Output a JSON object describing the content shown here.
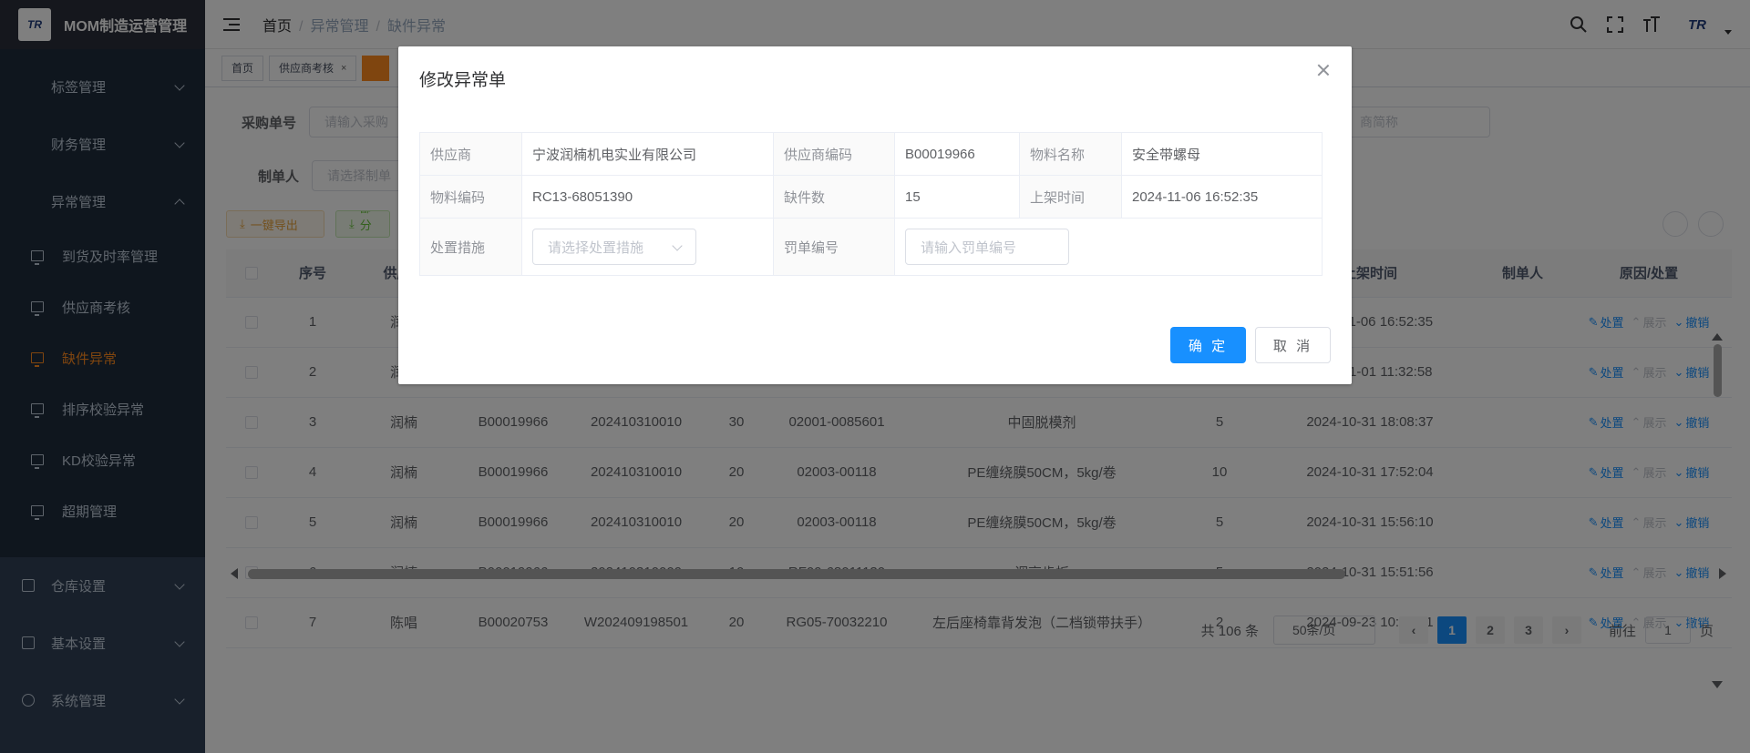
{
  "app": {
    "title": "MOM制造运营管理",
    "logo_text": "TR"
  },
  "sidebar": {
    "top_items": [
      {
        "label": "标签管理"
      },
      {
        "label": "财务管理"
      },
      {
        "label": "异常管理"
      }
    ],
    "sub_items": [
      {
        "label": "到货及时率管理"
      },
      {
        "label": "供应商考核"
      },
      {
        "label": "缺件异常"
      },
      {
        "label": "排序校验异常"
      },
      {
        "label": "KD校验异常"
      },
      {
        "label": "超期管理"
      }
    ],
    "lower_items": [
      {
        "label": "仓库设置"
      },
      {
        "label": "基本设置"
      },
      {
        "label": "系统管理"
      }
    ]
  },
  "breadcrumb": {
    "home": "首页",
    "section": "异常管理",
    "current": "缺件异常"
  },
  "tags": {
    "home": "首页",
    "supplier": "供应商考核",
    "close": "×"
  },
  "filters": {
    "purchase_no_label": "采购单号",
    "purchase_no_placeholder": "请输入采购",
    "creator_label": "制单人",
    "creator_placeholder": "请选择制单",
    "supplier_short_placeholder": "商简称"
  },
  "toolbar": {
    "export_label": "一键导出",
    "partial_label": "部分导"
  },
  "table": {
    "headers": {
      "index": "序号",
      "supplier": "供应商",
      "shelf_time": "上架时间",
      "creator": "制单人",
      "reason": "原因/处置"
    },
    "actions": {
      "handle": "处置",
      "show": "展示",
      "revoke": "撤销"
    },
    "rows": [
      {
        "idx": "1",
        "supplier": "润楠",
        "code": "",
        "po": "",
        "line": "",
        "material": "",
        "name": "",
        "qty": "",
        "time": "2024-11-06 16:52:35"
      },
      {
        "idx": "2",
        "supplier": "润楠",
        "code": "",
        "po": "",
        "line": "",
        "material": "",
        "name": "",
        "qty": "",
        "time": "2024-11-01 11:32:58"
      },
      {
        "idx": "3",
        "supplier": "润楠",
        "code": "B00019966",
        "po": "202410310010",
        "line": "30",
        "material": "02001-0085601",
        "name": "中固脱模剂",
        "qty": "5",
        "time": "2024-10-31 18:08:37"
      },
      {
        "idx": "4",
        "supplier": "润楠",
        "code": "B00019966",
        "po": "202410310010",
        "line": "20",
        "material": "02003-00118",
        "name": "PE缠绕膜50CM，5kg/卷",
        "qty": "10",
        "time": "2024-10-31 17:52:04"
      },
      {
        "idx": "5",
        "supplier": "润楠",
        "code": "B00019966",
        "po": "202410310010",
        "line": "20",
        "material": "02003-00118",
        "name": "PE缠绕膜50CM，5kg/卷",
        "qty": "5",
        "time": "2024-10-31 15:56:10"
      },
      {
        "idx": "6",
        "supplier": "润楠",
        "code": "B00019966",
        "po": "202410310009",
        "line": "10",
        "material": "RF09-68011130",
        "name": "调高齿板",
        "qty": "5",
        "time": "2024-10-31 15:51:56"
      },
      {
        "idx": "7",
        "supplier": "陈唱",
        "code": "B00020753",
        "po": "W202409198501",
        "line": "20",
        "material": "RG05-70032210",
        "name": "左后座椅靠背发泡（二档锁带扶手）",
        "qty": "2",
        "time": "2024-09-23 10:31:21"
      }
    ]
  },
  "pager": {
    "total": "共 106 条",
    "page_size": "50条/页",
    "pages": [
      "1",
      "2",
      "3"
    ],
    "goto_label": "前往",
    "goto_value": "1",
    "page_unit": "页"
  },
  "dialog": {
    "title": "修改异常单",
    "fields": {
      "supplier_label": "供应商",
      "supplier_value": "宁波润楠机电实业有限公司",
      "supplier_code_label": "供应商编码",
      "supplier_code_value": "B00019966",
      "material_name_label": "物料名称",
      "material_name_value": "安全带螺母",
      "material_code_label": "物料编码",
      "material_code_value": "RC13-68051390",
      "shortage_label": "缺件数",
      "shortage_value": "15",
      "shelf_time_label": "上架时间",
      "shelf_time_value": "2024-11-06 16:52:35",
      "measure_label": "处置措施",
      "measure_placeholder": "请选择处置措施",
      "penalty_label": "罚单编号",
      "penalty_placeholder": "请输入罚单编号"
    },
    "ok_label": "确 定",
    "cancel_label": "取 消"
  },
  "colors": {
    "primary": "#1890ff",
    "accent": "#ff8a1f",
    "sidebar": "#1f2d3d"
  }
}
